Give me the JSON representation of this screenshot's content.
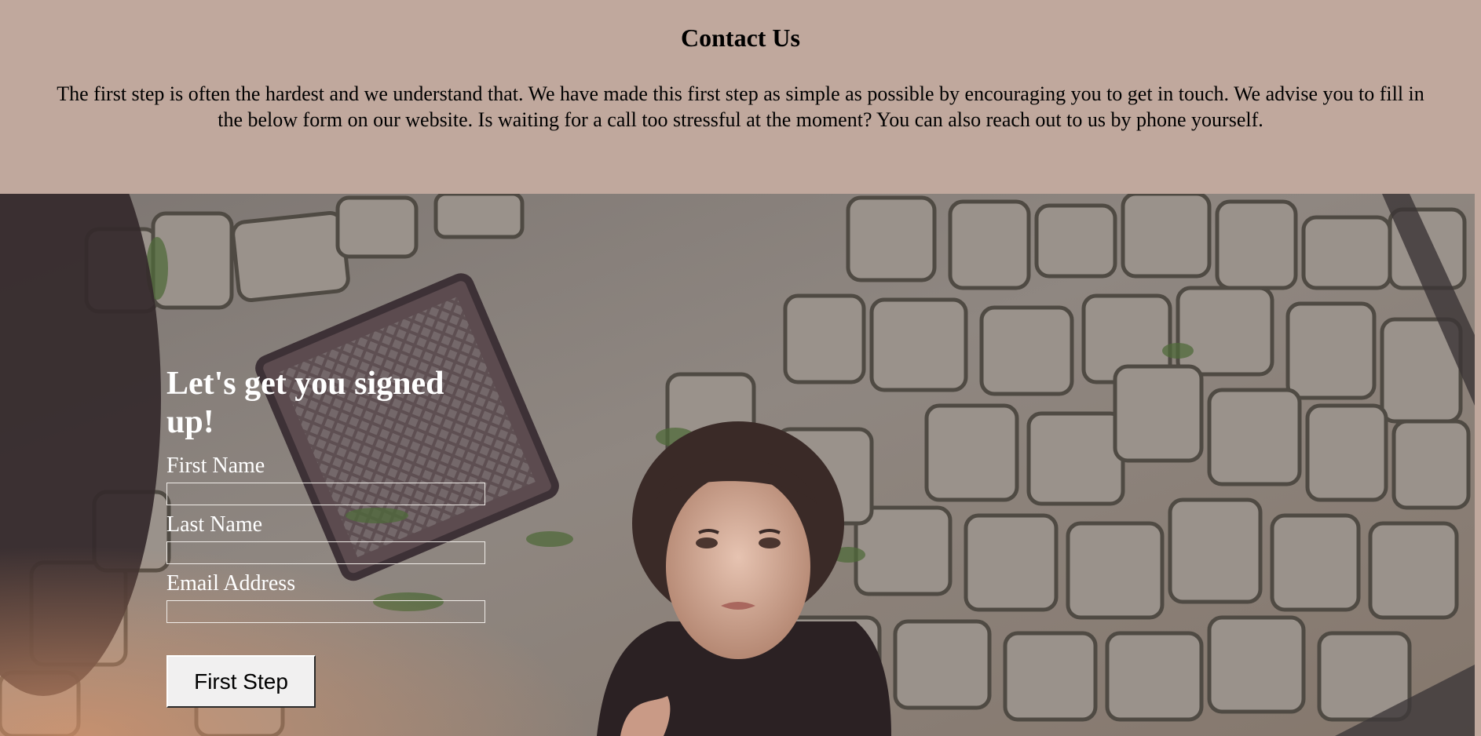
{
  "contact": {
    "title": "Contact Us",
    "text": "The first step is often the hardest and we understand that. We have made this first step as simple as possible by encouraging you to get in touch. We advise you to fill in the below form on our website. Is waiting for a call too stressful at the moment? You can also reach out to us by phone yourself."
  },
  "signup": {
    "heading": "Let's get you signed up!",
    "fields": [
      {
        "label": "First Name",
        "value": ""
      },
      {
        "label": "Last Name",
        "value": ""
      },
      {
        "label": "Email Address",
        "value": ""
      }
    ],
    "submit_label": "First Step"
  },
  "colors": {
    "band_background": "#c0a89d",
    "form_text": "#ffffff",
    "button_background": "#f1f0f0"
  }
}
